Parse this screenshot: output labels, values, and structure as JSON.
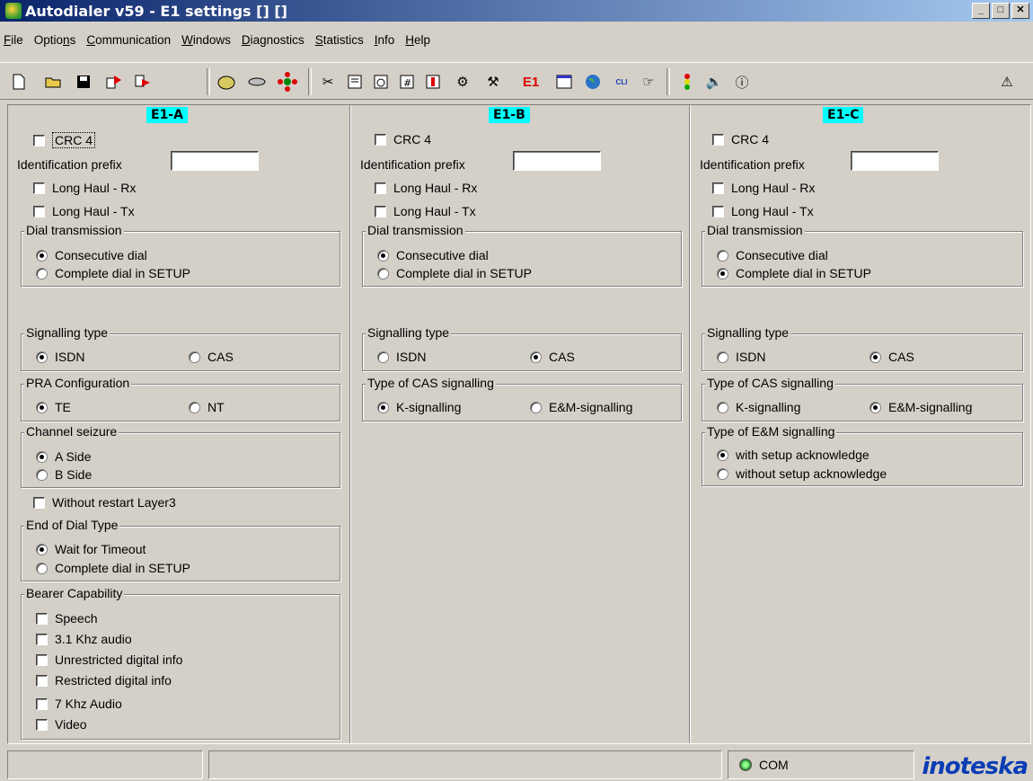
{
  "window": {
    "title": "Autodialer v59 - E1 settings [] []",
    "minimize": "_",
    "maximize": "□",
    "close": "✕"
  },
  "menu": [
    {
      "label": "File",
      "key": "F"
    },
    {
      "label": "Options",
      "key": "n"
    },
    {
      "label": "Communication",
      "key": "C"
    },
    {
      "label": "Windows",
      "key": "W"
    },
    {
      "label": "Diagnostics",
      "key": "D"
    },
    {
      "label": "Statistics",
      "key": "S"
    },
    {
      "label": "Info",
      "key": "I"
    },
    {
      "label": "Help",
      "key": "H"
    }
  ],
  "toolbar": {
    "icons": [
      "new-file-icon",
      "open-folder-icon",
      "save-icon",
      "copy-icon",
      "export-icon",
      "phone-book-icon",
      "cable-icon",
      "network-icon",
      "scissors-icon",
      "log-icon",
      "timer-icon",
      "calculator-icon",
      "alert-icon",
      "settings-icon",
      "tools-icon",
      "e1-icon",
      "calendar-icon",
      "globe-icon",
      "cli-icon",
      "hand-point-icon",
      "traffic-light-icon",
      "speaker-icon",
      "info-icon",
      "help-icon"
    ],
    "e1_label": "E1",
    "cli_label": "CLI"
  },
  "panels": [
    {
      "header": "E1-A",
      "crc4": {
        "label": "CRC 4",
        "checked": false
      },
      "id_prefix": {
        "label": "Identification prefix",
        "value": ""
      },
      "long_haul_rx": {
        "label": "Long Haul - Rx",
        "checked": false
      },
      "long_haul_tx": {
        "label": "Long Haul - Tx",
        "checked": false
      },
      "dial_transmission": {
        "label": "Dial transmission",
        "options": [
          "Consecutive dial",
          "Complete dial in SETUP"
        ],
        "selected": 0
      },
      "signalling_type": {
        "label": "Signalling type",
        "options": [
          "ISDN",
          "CAS"
        ],
        "selected": 0
      },
      "pra_configuration": {
        "label": "PRA Configuration",
        "options": [
          "TE",
          "NT"
        ],
        "selected": 0
      },
      "channel_seizure": {
        "label": "Channel seizure",
        "options": [
          "A Side",
          "B Side"
        ],
        "selected": 0
      },
      "without_restart": {
        "label": "Without restart Layer3",
        "checked": false
      },
      "end_of_dial": {
        "label": "End of Dial Type",
        "options": [
          "Wait for Timeout",
          "Complete dial in SETUP"
        ],
        "selected": 0
      },
      "bearer_capability": {
        "label": "Bearer Capability",
        "items": [
          {
            "label": "Speech",
            "checked": false
          },
          {
            "label": "3.1 Khz audio",
            "checked": false
          },
          {
            "label": "Unrestricted digital info",
            "checked": false
          },
          {
            "label": "Restricted digital info",
            "checked": false
          },
          {
            "label": "7 Khz Audio",
            "checked": false
          },
          {
            "label": "Video",
            "checked": false
          }
        ]
      }
    },
    {
      "header": "E1-B",
      "crc4": {
        "label": "CRC 4",
        "checked": false
      },
      "id_prefix": {
        "label": "Identification prefix",
        "value": ""
      },
      "long_haul_rx": {
        "label": "Long Haul - Rx",
        "checked": false
      },
      "long_haul_tx": {
        "label": "Long Haul - Tx",
        "checked": false
      },
      "dial_transmission": {
        "label": "Dial transmission",
        "options": [
          "Consecutive dial",
          "Complete dial in SETUP"
        ],
        "selected": 0
      },
      "signalling_type": {
        "label": "Signalling type",
        "options": [
          "ISDN",
          "CAS"
        ],
        "selected": 1
      },
      "cas_type": {
        "label": "Type of CAS signalling",
        "options": [
          "K-signalling",
          "E&M-signalling"
        ],
        "selected": 0
      }
    },
    {
      "header": "E1-C",
      "crc4": {
        "label": "CRC 4",
        "checked": false
      },
      "id_prefix": {
        "label": "Identification prefix",
        "value": ""
      },
      "long_haul_rx": {
        "label": "Long Haul - Rx",
        "checked": false
      },
      "long_haul_tx": {
        "label": "Long Haul - Tx",
        "checked": false
      },
      "dial_transmission": {
        "label": "Dial transmission",
        "options": [
          "Consecutive dial",
          "Complete dial in SETUP"
        ],
        "selected": 1
      },
      "signalling_type": {
        "label": "Signalling type",
        "options": [
          "ISDN",
          "CAS"
        ],
        "selected": 1
      },
      "cas_type": {
        "label": "Type of CAS signalling",
        "options": [
          "K-signalling",
          "E&M-signalling"
        ],
        "selected": 1
      },
      "em_type": {
        "label": "Type of E&M signalling",
        "options": [
          "with setup acknowledge",
          "without setup acknowledge"
        ],
        "selected": 0
      }
    }
  ],
  "status": {
    "panel1": "",
    "panel2": "",
    "com_label": "COM",
    "brand": "inoteska"
  }
}
